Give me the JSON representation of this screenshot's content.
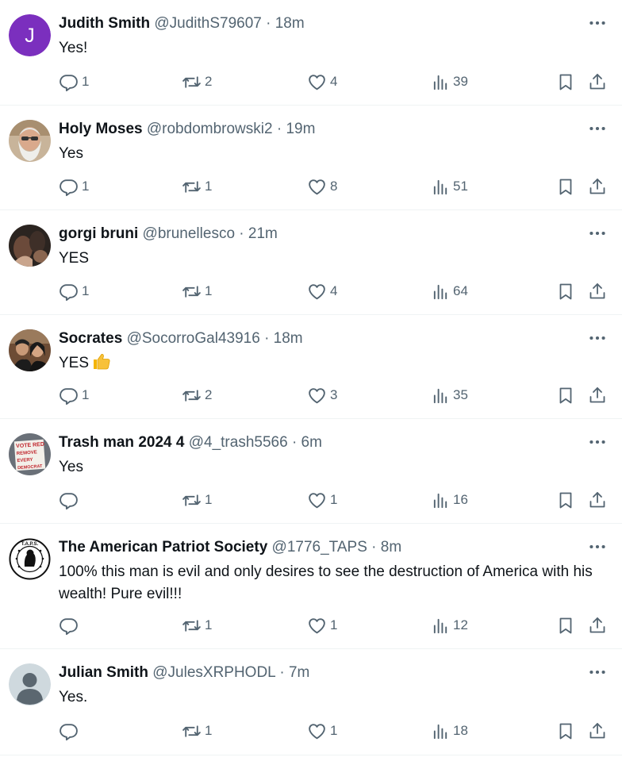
{
  "colors": {
    "secondary": "#536471",
    "text": "#0f1419",
    "divider": "#eff3f4",
    "avatar_purple": "#7b2fbe"
  },
  "tweets": [
    {
      "name": "Judith Smith",
      "handle": "@JudithS79607",
      "dot": "·",
      "time": "18m",
      "text": "Yes!",
      "avatar": "letter-avatar",
      "avatar_letter": "J",
      "replies": "1",
      "reposts": "2",
      "likes": "4",
      "views": "39"
    },
    {
      "name": "Holy Moses",
      "handle": "@robdombrowski2",
      "dot": "·",
      "time": "19m",
      "text": "Yes",
      "avatar": "bearded-man-photo",
      "replies": "1",
      "reposts": "1",
      "likes": "8",
      "views": "51"
    },
    {
      "name": "gorgi bruni",
      "handle": "@brunellesco",
      "dot": "·",
      "time": "21m",
      "text": "YES",
      "avatar": "dark-photo",
      "replies": "1",
      "reposts": "1",
      "likes": "4",
      "views": "64"
    },
    {
      "name": "Socrates",
      "handle": "@SocorroGal43916",
      "dot": "·",
      "time": "18m",
      "text": "YES",
      "emoji": "thumbs-up-icon",
      "avatar": "couple-photo",
      "replies": "1",
      "reposts": "2",
      "likes": "3",
      "views": "35"
    },
    {
      "name": "Trash man 2024 4",
      "handle": "@4_trash5566",
      "dot": "·",
      "time": "6m",
      "text": "Yes",
      "avatar": "vote-red-sign",
      "avatar_sign": [
        "VOTE RED",
        "REMOVE",
        "EVERY",
        "DEMOCRAT"
      ],
      "replies": "",
      "reposts": "1",
      "likes": "1",
      "views": "16"
    },
    {
      "name": "The American Patriot Society",
      "handle": "@1776_TAPS",
      "dot": "·",
      "time": "8m",
      "text": "100% this man is evil and only desires to see the destruction of America with his wealth! Pure evil!!!",
      "avatar": "patriot-seal",
      "avatar_seal": "T.A.P.S.",
      "replies": "",
      "reposts": "1",
      "likes": "1",
      "views": "12"
    },
    {
      "name": "Julian Smith",
      "handle": "@JulesXRPHODL",
      "dot": "·",
      "time": "7m",
      "text": "Yes.",
      "avatar": "default-avatar",
      "replies": "",
      "reposts": "1",
      "likes": "1",
      "views": "18"
    }
  ]
}
